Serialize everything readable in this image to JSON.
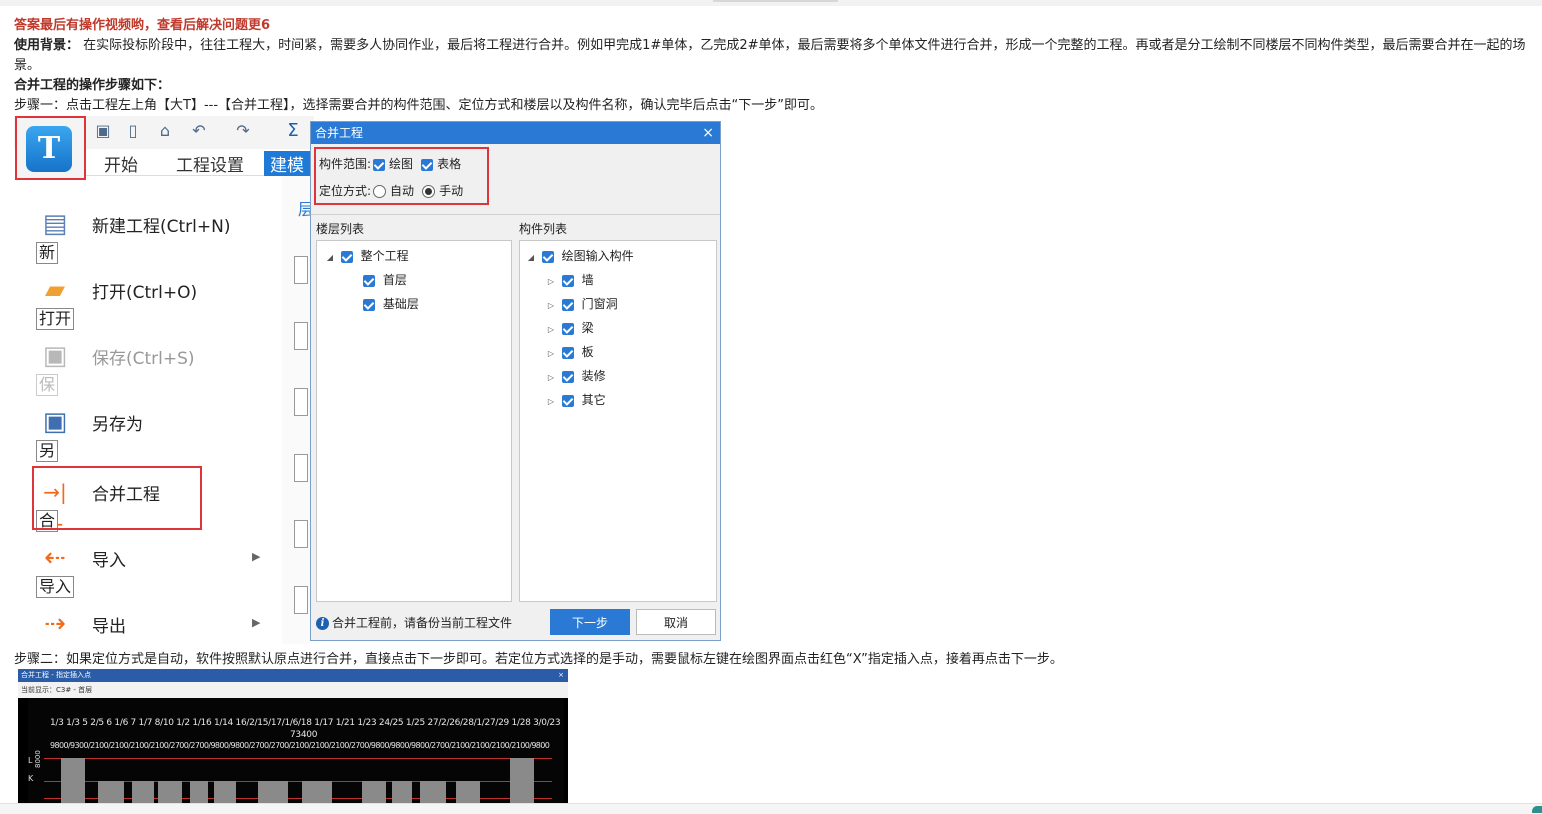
{
  "doc": {
    "headline": "答案最后有操作视频哟，查看后解决问题更6",
    "background_label": "使用背景：",
    "background_text": "在实际投标阶段中，往往工程大，时间紧，需要多人协同作业，最后将工程进行合并。例如甲完成1#单体，乙完成2#单体，最后需要将多个单体文件进行合并，形成一个完整的工程。再或者是分工绘制不同楼层不同构件类型，最后需要合并在一起的场景。",
    "steps_heading": "合并工程的操作步骤如下：",
    "step1": "步骤一：点击工程左上角【大T】---【合并工程】，选择需要合并的构件范围、定位方式和楼层以及构件名称，确认完毕后点击“下一步”即可。",
    "step2": "步骤二：如果定位方式是自动，软件按照默认原点进行合并，直接点击下一步即可。若定位方式选择的是手动，需要鼠标左键在绘图界面点击红色“X”指定插入点，接着再点击下一步。"
  },
  "app": {
    "logo_letter": "T",
    "sigma": "Σ",
    "ribbon_tabs": [
      "开始",
      "工程设置",
      "建模"
    ],
    "menu": [
      {
        "label": "新建工程(Ctrl+N)",
        "tip": "新",
        "disabled": false
      },
      {
        "label": "打开(Ctrl+O)",
        "tip": "打开",
        "disabled": false
      },
      {
        "label": "保存(Ctrl+S)",
        "tip": "保",
        "disabled": true
      },
      {
        "label": "另存为",
        "tip": "另",
        "disabled": false
      },
      {
        "label": "合并工程",
        "tip": "合",
        "disabled": false
      },
      {
        "label": "导入",
        "tip": "导入",
        "disabled": false
      },
      {
        "label": "导出",
        "tip": "",
        "disabled": false
      }
    ],
    "side_char": "层"
  },
  "dialog": {
    "title": "合并工程",
    "close": "×",
    "scope_label": "构件范围:",
    "scope_draw": "绘图",
    "scope_table": "表格",
    "position_label": "定位方式:",
    "position_auto": "自动",
    "position_manual": "手动",
    "position_selected": "手动",
    "floor_list_label": "楼层列表",
    "component_list_label": "构件列表",
    "floors": {
      "root": "整个工程",
      "children": [
        "首层",
        "基础层"
      ]
    },
    "components": {
      "root": "绘图输入构件",
      "children": [
        "墙",
        "门窗洞",
        "梁",
        "板",
        "装修",
        "其它"
      ]
    },
    "info": "合并工程前，请备份当前工程文件",
    "next_button": "下一步",
    "cancel_button": "取消"
  },
  "insert_window": {
    "title": "合并工程 - 指定插入点",
    "close": "×",
    "current": "当前显示：C3# - 首层",
    "dims_top": "1/3  1/3  5  2/5  6  1/6  7   1/7   8/10 1/2  1/16 1/14  16/2/15/17/1/6/18  1/17  1/21 1/23  24/25  1/25  27/2/26/28/1/27/29  1/28  3/0/23",
    "dims_total": "73400",
    "dims_row": "9800/9300/2100/2100/2100/2100/2700/2700/9800/9800/2700/2700/2100/2100/2100/2700/9800/9800/9800/2700/2100/2100/2100/2100/9800",
    "axis_labels": [
      "L",
      "K"
    ],
    "side_dim": "8000"
  }
}
